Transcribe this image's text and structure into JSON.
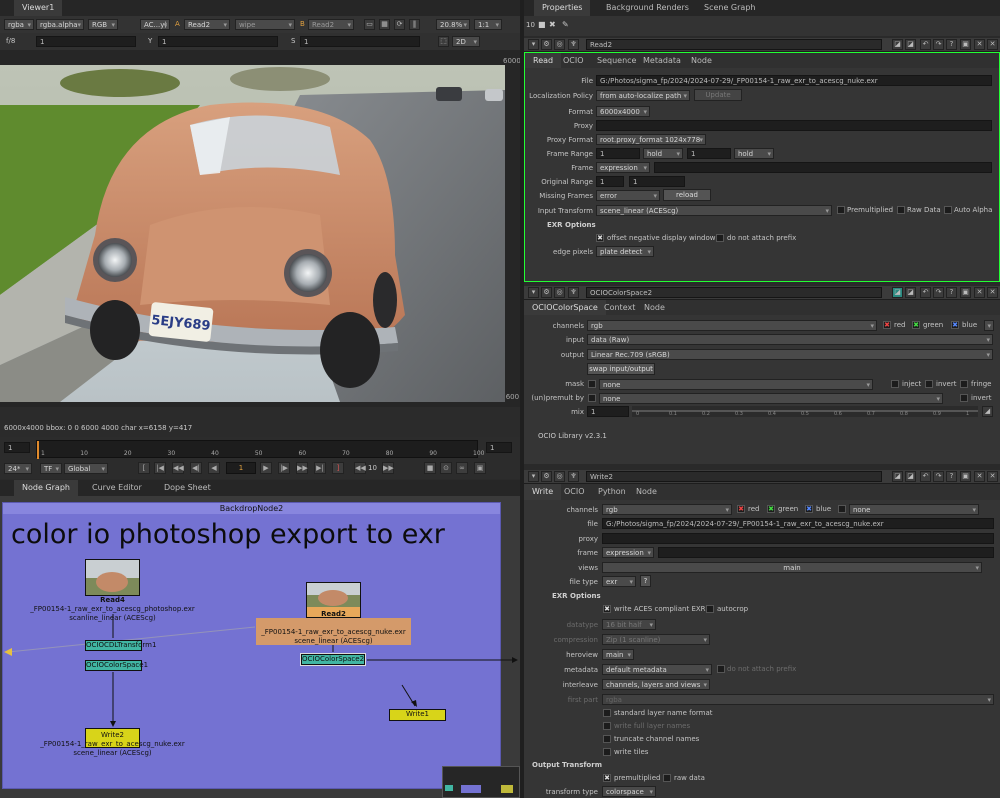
{
  "viewer": {
    "tab": "Viewer1",
    "toolbar1": {
      "channels": "rgba",
      "alpha": "rgba.alpha",
      "colorspace": "RGB",
      "ac": "AC...y)",
      "a_label": "A",
      "a_input": "Read2",
      "wipe": "wipe",
      "b_label": "B",
      "b_input": "Read2",
      "zoom": "20.8%",
      "ratio": "1:1"
    },
    "toolbar2": {
      "fstop": "f/8",
      "x_val": "1",
      "y_label": "Y",
      "y_val": "1",
      "s_label": "S",
      "s_val": "1",
      "mode": "2D"
    },
    "res_top": "6000",
    "res_side": "(600",
    "info": "6000x4000  bbox: 0 0 6000 4000 char  x=6158 y=417",
    "plate": "5EJY689",
    "timeline": {
      "ticks": [
        "1",
        "10",
        "20",
        "30",
        "40",
        "50",
        "60",
        "70",
        "80",
        "90",
        "100"
      ],
      "start": "1",
      "end": "1",
      "fps": "24*",
      "tf": "TF",
      "range": "Global",
      "frame": "1",
      "step": "10"
    }
  },
  "nodegraph": {
    "tabs": [
      "Node Graph",
      "Curve Editor",
      "Dope Sheet"
    ],
    "backdrop": {
      "name": "BackdropNode2",
      "title": "color io photoshop  export to exr"
    },
    "nodes": {
      "read4": {
        "name": "Read4",
        "file": "_FP00154-1_raw_exr_to_acescg_photoshop.exr",
        "cs": "scanline_linear (ACEScg)"
      },
      "ociocdl": {
        "name": "OCIOCDLTransform1"
      },
      "ociocs1": {
        "name": "OCIOColorSpace1"
      },
      "write2": {
        "name": "Write2",
        "file": "_FP00154-1_raw_exr_to_acescg_nuke.exr",
        "cs": "scene_linear (ACEScg)"
      },
      "read2": {
        "name": "Read2",
        "file": "_FP00154-1_raw_exr_to_acescg_nuke.exr",
        "cs": "scene_linear (ACEScg)"
      },
      "ociocs2": {
        "name": "OCIOColorSpace2"
      },
      "write1": {
        "name": "Write1"
      }
    }
  },
  "properties": {
    "tabs": [
      "Properties",
      "Background Renders",
      "Scene Graph"
    ],
    "count": "10",
    "read2": {
      "name": "Read2",
      "tabs": [
        "Read",
        "OCIO",
        "Sequence",
        "Metadata",
        "Node"
      ],
      "file_label": "File",
      "file": "G:/Photos/sigma_fp/2024/2024-07-29/_FP00154-1_raw_exr_to_acescg_nuke.exr",
      "loc_label": "Localization Policy",
      "loc": "from auto-localize path",
      "update": "Update",
      "format_label": "Format",
      "format": "6000x4000",
      "proxy_label": "Proxy",
      "proxyfmt_label": "Proxy Format",
      "proxyfmt": "root.proxy_format 1024x778",
      "framerange_label": "Frame Range",
      "fr_start": "1",
      "fr_before": "hold",
      "fr_end": "1",
      "fr_after": "hold",
      "frame_label": "Frame",
      "frame": "expression",
      "origrange_label": "Original Range",
      "or_start": "1",
      "or_end": "1",
      "missing_label": "Missing Frames",
      "missing": "error",
      "reload": "reload",
      "inputtf_label": "Input Transform",
      "inputtf": "scene_linear (ACEScg)",
      "premult": "Premultiplied",
      "raw": "Raw Data",
      "autoalpha": "Auto Alpha",
      "exr_section": "EXR Options",
      "offset": "offset negative display window",
      "noattach": "do not attach prefix",
      "edge_label": "edge pixels",
      "edge": "plate detect"
    },
    "ocio": {
      "name": "OCIOColorSpace2",
      "tabs": [
        "OCIOColorSpace",
        "Context",
        "Node"
      ],
      "channels_label": "channels",
      "channels": "rgb",
      "red": "red",
      "green": "green",
      "blue": "blue",
      "input_label": "input",
      "input": "data (Raw)",
      "output_label": "output",
      "output": "Linear Rec.709 (sRGB)",
      "swap": "swap input/output",
      "mask_label": "mask",
      "mask": "none",
      "inject": "inject",
      "invert": "invert",
      "fringe": "fringe",
      "unpremult_label": "(un)premult by",
      "unpremult": "none",
      "invert2": "invert",
      "mix_label": "mix",
      "mix": "1",
      "mix_ticks": [
        "0",
        "0.1",
        "0.2",
        "0.3",
        "0.4",
        "0.5",
        "0.6",
        "0.7",
        "0.8",
        "0.9",
        "1"
      ],
      "lib": "OCIO Library  v2.3.1"
    },
    "write2": {
      "name": "Write2",
      "tabs": [
        "Write",
        "OCIO",
        "Python",
        "Node"
      ],
      "channels_label": "channels",
      "channels": "rgb",
      "red": "red",
      "green": "green",
      "blue": "blue",
      "none": "none",
      "file_label": "file",
      "file": "G:/Photos/sigma_fp/2024/2024-07-29/_FP00154-1_raw_exr_to_acescg_nuke.exr",
      "proxy_label": "proxy",
      "frame_label": "frame",
      "frame": "expression",
      "views_label": "views",
      "views": "main",
      "filetype_label": "file type",
      "filetype": "exr",
      "help": "?",
      "exr_section": "EXR Options",
      "aces": "write ACES compliant EXR",
      "autocrop": "autocrop",
      "datatype_label": "datatype",
      "datatype": "16 bit half",
      "compression_label": "compression",
      "compression": "Zip (1 scanline)",
      "heroview_label": "heroview",
      "heroview": "main",
      "metadata_label": "metadata",
      "metadata": "default metadata",
      "noattach": "do not attach prefix",
      "interleave_label": "interleave",
      "interleave": "channels, layers and views",
      "firstpart_label": "first part",
      "firstpart": "rgba",
      "stdlayer": "standard layer name format",
      "fulllayer": "write full layer names",
      "truncate": "truncate channel names",
      "tiles": "write tiles",
      "output_section": "Output Transform",
      "premult": "premultiplied",
      "raw": "raw data",
      "tt_label": "transform type",
      "tt": "colorspace"
    }
  }
}
